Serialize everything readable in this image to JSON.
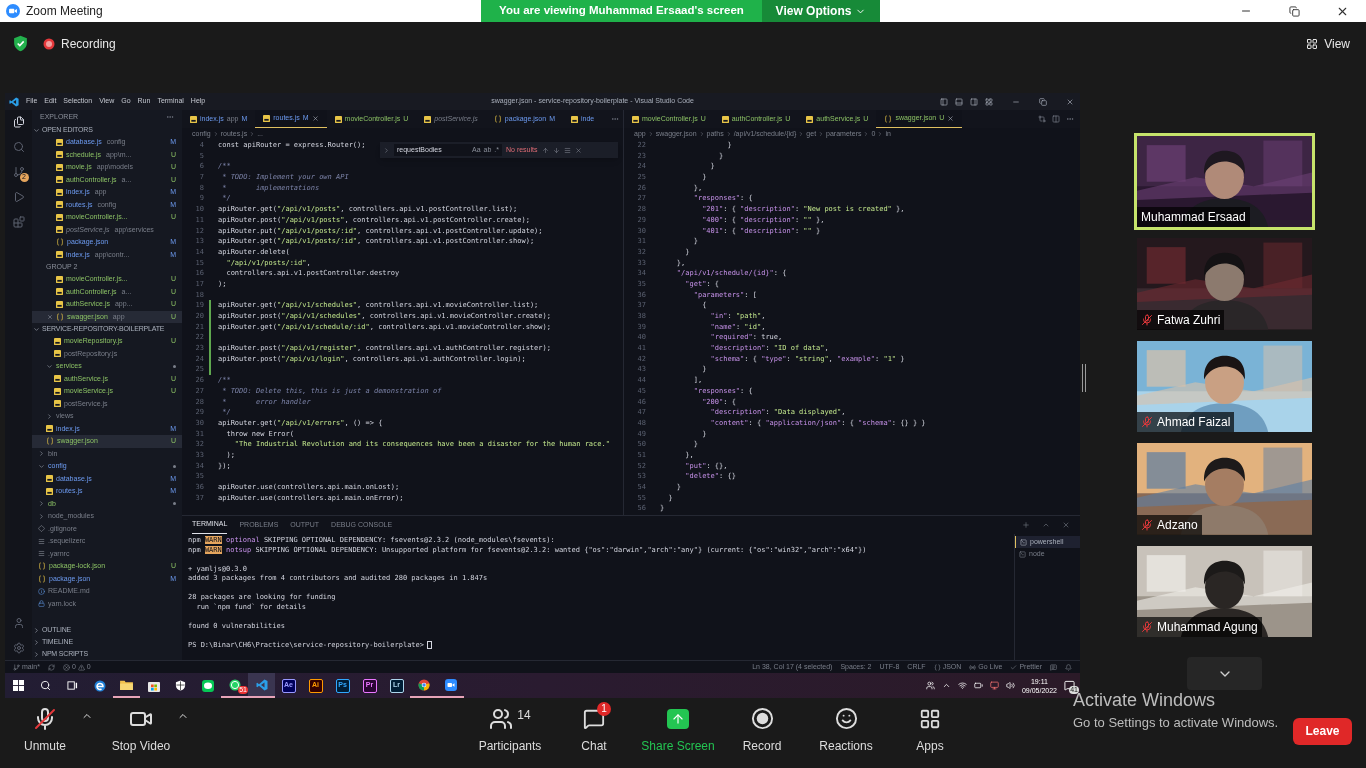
{
  "zoom": {
    "title": "Zoom Meeting",
    "banner": "You are viewing Muhammad Ersaad's screen",
    "view_options": "View Options",
    "recording": "Recording",
    "view": "View"
  },
  "vscode": {
    "menu": [
      "File",
      "Edit",
      "Selection",
      "View",
      "Go",
      "Run",
      "Terminal",
      "Help"
    ],
    "title": "swagger.json - service-repository-boilerplate - Visual Studio Code",
    "scm_badge": "2",
    "explorer": {
      "title": "EXPLORER",
      "open_editors": {
        "title": "OPEN EDITORS",
        "items": [
          {
            "name": "database.js",
            "detail": "config",
            "badge": "M",
            "kind": "js",
            "modified": true,
            "untracked": false,
            "selected": false
          },
          {
            "name": "schedule.js",
            "detail": "app\\m...",
            "badge": "U",
            "kind": "js",
            "modified": false,
            "untracked": true,
            "selected": false
          },
          {
            "name": "movie.js",
            "detail": "app\\models",
            "badge": "U",
            "kind": "js",
            "modified": false,
            "untracked": true,
            "selected": false
          },
          {
            "name": "authController.js",
            "detail": "a...",
            "badge": "U",
            "kind": "js",
            "modified": false,
            "untracked": true,
            "selected": false
          },
          {
            "name": "index.js",
            "detail": "app",
            "badge": "M",
            "kind": "js",
            "modified": true,
            "untracked": false,
            "selected": false
          },
          {
            "name": "routes.js",
            "detail": "config",
            "badge": "M",
            "kind": "js",
            "modified": true,
            "untracked": false,
            "selected": false
          },
          {
            "name": "movieController.js...",
            "badge": "U",
            "kind": "js",
            "modified": false,
            "untracked": true,
            "selected": false
          },
          {
            "name": "postService.js",
            "detail": "app\\services",
            "kind": "js",
            "modified": false,
            "untracked": false,
            "selected": false
          },
          {
            "name": "package.json",
            "badge": "M",
            "kind": "json",
            "modified": true,
            "untracked": false,
            "selected": false
          },
          {
            "name": "index.js",
            "detail": "app\\contr...",
            "badge": "M",
            "kind": "js",
            "modified": true,
            "untracked": false,
            "selected": false
          }
        ]
      },
      "group2": {
        "title": "GROUP 2",
        "items": [
          {
            "name": "movieController.js...",
            "badge": "U",
            "kind": "js",
            "modified": false,
            "untracked": true,
            "selected": false
          },
          {
            "name": "authController.js",
            "detail": "a...",
            "badge": "U",
            "kind": "js",
            "modified": false,
            "untracked": true,
            "selected": false
          },
          {
            "name": "authService.js",
            "detail": "app...",
            "badge": "U",
            "kind": "js",
            "modified": false,
            "untracked": true,
            "selected": false
          },
          {
            "name": "swagger.json",
            "detail": "app",
            "badge": "U",
            "kind": "json",
            "modified": false,
            "untracked": true,
            "selected": true
          }
        ]
      },
      "project": {
        "title": "SERVICE-REPOSITORY-BOILERPLATE",
        "items": [
          {
            "children": [
              {
                "children": [
                  {
                    "name": "movieRepository.js",
                    "badge": "U",
                    "kind": "js",
                    "modified": false,
                    "untracked": true,
                    "selected": false
                  },
                  {
                    "name": "postRepository.js",
                    "kind": "js",
                    "modified": false,
                    "untracked": false,
                    "selected": false
                  }
                ]
              },
              {
                "name": "services",
                "kind": "folder",
                "expanded": true,
                "dot": true,
                "modified": false,
                "untracked": true,
                "selected": false,
                "children": [
                  {
                    "name": "authService.js",
                    "badge": "U",
                    "kind": "js",
                    "modified": false,
                    "untracked": true,
                    "selected": false
                  },
                  {
                    "name": "movieService.js",
                    "badge": "U",
                    "kind": "js",
                    "modified": false,
                    "untracked": true,
                    "selected": false
                  },
                  {
                    "name": "postService.js",
                    "kind": "js",
                    "modified": false,
                    "untracked": false,
                    "selected": false
                  }
                ]
              },
              {
                "name": "views",
                "kind": "folder",
                "expanded": false,
                "dot": false,
                "modified": false,
                "untracked": false,
                "selected": false
              },
              {
                "name": "index.js",
                "badge": "M",
                "kind": "js",
                "modified": true,
                "untracked": false,
                "selected": false
              },
              {
                "name": "swagger.json",
                "badge": "U",
                "kind": "json",
                "modified": false,
                "untracked": true,
                "selected": true
              }
            ]
          },
          {
            "name": "bin",
            "kind": "folder",
            "expanded": false,
            "dot": false,
            "modified": false,
            "untracked": false,
            "selected": false
          },
          {
            "name": "config",
            "kind": "folder",
            "expanded": true,
            "dot": true,
            "modified": true,
            "untracked": false,
            "selected": false,
            "children": [
              {
                "name": "database.js",
                "badge": "M",
                "kind": "js",
                "modified": true,
                "untracked": false,
                "selected": false
              },
              {
                "name": "routes.js",
                "badge": "M",
                "kind": "js",
                "modified": true,
                "untracked": false,
                "selected": false
              }
            ]
          },
          {
            "name": "db",
            "kind": "folder",
            "expanded": false,
            "dot": true,
            "modified": false,
            "untracked": true,
            "selected": false
          },
          {
            "name": "node_modules",
            "kind": "folder",
            "expanded": false,
            "dot": false,
            "modified": false,
            "untracked": false,
            "selected": false
          },
          {
            "name": ".gitignore",
            "kind": "git",
            "modified": false,
            "untracked": false,
            "selected": false
          },
          {
            "name": ".sequelizerc",
            "kind": "config",
            "modified": false,
            "untracked": false,
            "selected": false
          },
          {
            "name": ".yarnrc",
            "kind": "config",
            "modified": false,
            "untracked": false,
            "selected": false
          },
          {
            "name": "package-lock.json",
            "badge": "U",
            "kind": "json",
            "modified": false,
            "untracked": true,
            "selected": false
          },
          {
            "name": "package.json",
            "badge": "M",
            "kind": "json",
            "modified": true,
            "untracked": false,
            "selected": false
          },
          {
            "name": "README.md",
            "kind": "md",
            "modified": false,
            "untracked": false,
            "selected": false
          },
          {
            "name": "yarn.lock",
            "kind": "lock",
            "modified": false,
            "untracked": false,
            "selected": false
          }
        ]
      },
      "sections": [
        "OUTLINE",
        "TIMELINE",
        "NPM SCRIPTS"
      ]
    },
    "editors": [
      {
        "tabs": [
          {
            "name": "index.js",
            "detail": "app",
            "badge": "M",
            "kind": "js",
            "modified": true,
            "untracked": false,
            "selected": false
          },
          {
            "name": "routes.js",
            "badge": "M",
            "kind": "js",
            "modified": true,
            "untracked": false,
            "selected": true
          },
          {
            "name": "movieController.js",
            "badge": "U",
            "kind": "js",
            "modified": false,
            "untracked": true,
            "selected": false
          },
          {
            "name": "postService.js",
            "kind": "js",
            "modified": false,
            "untracked": false,
            "selected": false
          },
          {
            "name": "package.json",
            "badge": "M",
            "kind": "json",
            "modified": true,
            "untracked": false,
            "selected": false
          },
          {
            "name": "inde",
            "kind": "js",
            "modified": true,
            "untracked": false,
            "selected": false
          }
        ],
        "breadcrumbs": [
          "config",
          "routes.js",
          "..."
        ],
        "find": {
          "value": "requestBodies",
          "options": [
            "Aa",
            "ab",
            ".*"
          ],
          "result": "No results"
        },
        "lines": [
          {
            "n": "4",
            "text": "const apiRouter = express.Router();",
            "kind": "code",
            "added": false
          },
          {
            "n": "5",
            "kind": "code",
            "added": false
          },
          {
            "n": "6",
            "text": "/**",
            "kind": "comment",
            "added": false
          },
          {
            "n": "7",
            "text": " * TODO: Implement your own API",
            "kind": "comment",
            "added": false
          },
          {
            "n": "8",
            "text": " *       implementations",
            "kind": "comment",
            "added": false
          },
          {
            "n": "9",
            "text": " */",
            "kind": "comment",
            "added": false
          },
          {
            "n": "10",
            "text": "apiRouter.get(\"/api/v1/posts\", controllers.api.v1.postController.list);",
            "kind": "code",
            "added": false
          },
          {
            "n": "11",
            "text": "apiRouter.post(\"/api/v1/posts\", controllers.api.v1.postController.create);",
            "kind": "code",
            "added": false
          },
          {
            "n": "12",
            "text": "apiRouter.put(\"/api/v1/posts/:id\", controllers.api.v1.postController.update);",
            "kind": "code",
            "added": false
          },
          {
            "n": "13",
            "text": "apiRouter.get(\"/api/v1/posts/:id\", controllers.api.v1.postController.show);",
            "kind": "code",
            "added": false
          },
          {
            "n": "14",
            "text": "apiRouter.delete(",
            "kind": "code",
            "added": false
          },
          {
            "n": "15",
            "text": "  \"/api/v1/posts/:id\",",
            "kind": "code",
            "added": false
          },
          {
            "n": "16",
            "text": "  controllers.api.v1.postController.destroy",
            "kind": "code",
            "added": false
          },
          {
            "n": "17",
            "text": ");",
            "kind": "code",
            "added": false
          },
          {
            "n": "18",
            "kind": "code",
            "added": false
          },
          {
            "n": "19",
            "text": "apiRouter.get(\"/api/v1/schedules\", controllers.api.v1.movieController.list);",
            "kind": "code",
            "added": true
          },
          {
            "n": "20",
            "text": "apiRouter.post(\"/api/v1/schedules\", controllers.api.v1.movieController.create);",
            "kind": "code",
            "added": true
          },
          {
            "n": "21",
            "text": "apiRouter.get(\"/api/v1/schedule/:id\", controllers.api.v1.movieController.show);",
            "kind": "code",
            "added": true
          },
          {
            "n": "22",
            "kind": "code",
            "added": true
          },
          {
            "n": "23",
            "text": "apiRouter.post(\"/api/v1/register\", controllers.api.v1.authController.register);",
            "kind": "code",
            "added": true
          },
          {
            "n": "24",
            "text": "apiRouter.post(\"/api/v1/login\", controllers.api.v1.authController.login);",
            "kind": "code",
            "added": true
          },
          {
            "n": "25",
            "kind": "code",
            "added": true
          },
          {
            "n": "26",
            "text": "/**",
            "kind": "comment",
            "added": false
          },
          {
            "n": "27",
            "text": " * TODO: Delete this, this is just a demonstration of",
            "kind": "comment",
            "added": false
          },
          {
            "n": "28",
            "text": " *       error handler",
            "kind": "comment",
            "added": false
          },
          {
            "n": "29",
            "text": " */",
            "kind": "comment",
            "added": false
          },
          {
            "n": "30",
            "text": "apiRouter.get(\"/api/v1/errors\", () => {",
            "kind": "code",
            "added": false
          },
          {
            "n": "31",
            "text": "  throw new Error(",
            "kind": "code",
            "added": false
          },
          {
            "n": "32",
            "text": "    \"The Industrial Revolution and its consequences have been a disaster for the human race.\"",
            "kind": "code",
            "added": false
          },
          {
            "n": "33",
            "text": "  );",
            "kind": "code",
            "added": false
          },
          {
            "n": "34",
            "text": "});",
            "kind": "code",
            "added": false
          },
          {
            "n": "35",
            "kind": "code",
            "added": false
          },
          {
            "n": "36",
            "text": "apiRouter.use(controllers.api.main.onLost);",
            "kind": "code",
            "added": false
          },
          {
            "n": "37",
            "text": "apiRouter.use(controllers.api.main.onError);",
            "kind": "code",
            "added": false
          }
        ]
      },
      {
        "tabs": [
          {
            "name": "movieController.js",
            "badge": "U",
            "kind": "js",
            "modified": false,
            "untracked": true,
            "selected": false
          },
          {
            "name": "authController.js",
            "badge": "U",
            "kind": "js",
            "modified": false,
            "untracked": true,
            "selected": false
          },
          {
            "name": "authService.js",
            "badge": "U",
            "kind": "js",
            "modified": false,
            "untracked": true,
            "selected": false
          },
          {
            "name": "swagger.json",
            "badge": "U",
            "kind": "json",
            "modified": false,
            "untracked": true,
            "selected": true
          }
        ],
        "breadcrumbs": [
          "app",
          "swagger.json",
          "paths",
          "/api/v1/schedule/{id}",
          "get",
          "parameters",
          "0",
          "in"
        ],
        "lines": [
          {
            "n": "22",
            "text": "                }",
            "kind": "code",
            "added": false
          },
          {
            "n": "23",
            "text": "              }",
            "kind": "code",
            "added": false
          },
          {
            "n": "24",
            "text": "            }",
            "kind": "code",
            "added": false
          },
          {
            "n": "25",
            "text": "          }",
            "kind": "code",
            "added": false
          },
          {
            "n": "26",
            "text": "        },",
            "kind": "code",
            "added": false
          },
          {
            "n": "27",
            "text": "        \"responses\": {",
            "kind": "code",
            "added": false
          },
          {
            "n": "28",
            "text": "          \"201\": { \"description\": \"New post is created\" },",
            "kind": "code",
            "added": false
          },
          {
            "n": "29",
            "text": "          \"400\": { \"description\": \"\" },",
            "kind": "code",
            "added": false
          },
          {
            "n": "30",
            "text": "          \"401\": { \"description\": \"\" }",
            "kind": "code",
            "added": false
          },
          {
            "n": "31",
            "text": "        }",
            "kind": "code",
            "added": false
          },
          {
            "n": "32",
            "text": "      }",
            "kind": "code",
            "added": false
          },
          {
            "n": "33",
            "text": "    },",
            "kind": "code",
            "added": false
          },
          {
            "n": "34",
            "text": "    \"/api/v1/schedule/{id}\": {",
            "kind": "code",
            "added": false
          },
          {
            "n": "35",
            "text": "      \"get\": {",
            "kind": "code",
            "added": false
          },
          {
            "n": "36",
            "text": "        \"parameters\": [",
            "kind": "code",
            "added": false
          },
          {
            "n": "37",
            "text": "          {",
            "kind": "code",
            "added": false
          },
          {
            "n": "38",
            "text": "            \"in\": \"path\",",
            "kind": "code",
            "added": false
          },
          {
            "n": "39",
            "text": "            \"name\": \"id\",",
            "kind": "code",
            "added": false
          },
          {
            "n": "40",
            "text": "            \"required\": true,",
            "kind": "code",
            "added": false
          },
          {
            "n": "41",
            "text": "            \"description\": \"ID of data\",",
            "kind": "code",
            "added": false
          },
          {
            "n": "42",
            "text": "            \"schema\": { \"type\": \"string\", \"example\": \"1\" }",
            "kind": "code",
            "added": false
          },
          {
            "n": "43",
            "text": "          }",
            "kind": "code",
            "added": false
          },
          {
            "n": "44",
            "text": "        ],",
            "kind": "code",
            "added": false
          },
          {
            "n": "45",
            "text": "        \"responses\": {",
            "kind": "code",
            "added": false
          },
          {
            "n": "46",
            "text": "          \"200\": {",
            "kind": "code",
            "added": false
          },
          {
            "n": "47",
            "text": "            \"description\": \"Data displayed\",",
            "kind": "code",
            "added": false
          },
          {
            "n": "48",
            "text": "            \"content\": { \"application/json\": { \"schema\": {} } }",
            "kind": "code",
            "added": false
          },
          {
            "n": "49",
            "text": "          }",
            "kind": "code",
            "added": false
          },
          {
            "n": "50",
            "text": "        }",
            "kind": "code",
            "added": false
          },
          {
            "n": "51",
            "text": "      },",
            "kind": "code",
            "added": false
          },
          {
            "n": "52",
            "text": "      \"put\": {},",
            "kind": "code",
            "added": false
          },
          {
            "n": "53",
            "text": "      \"delete\": {}",
            "kind": "code",
            "added": false
          },
          {
            "n": "54",
            "text": "    }",
            "kind": "code",
            "added": false
          },
          {
            "n": "55",
            "text": "  }",
            "kind": "code",
            "added": false
          },
          {
            "n": "56",
            "text": "}",
            "kind": "code",
            "added": false
          }
        ]
      }
    ],
    "panel": {
      "tabs": [
        {
          "label": "TERMINAL",
          "selected": true
        },
        {
          "label": "PROBLEMS",
          "selected": false
        },
        {
          "label": "OUTPUT",
          "selected": false
        },
        {
          "label": "DEBUG CONSOLE",
          "selected": false
        }
      ],
      "blocks": [
        [
          {
            "kind": "warn",
            "prefix": "npm",
            "tag": "WARN",
            "keyword": "optional",
            "text": "SKIPPING OPTIONAL DEPENDENCY: fsevents@2.3.2 (node_modules\\fsevents):"
          },
          {
            "kind": "warn",
            "prefix": "npm",
            "tag": "WARN",
            "keyword": "notsup",
            "text": "SKIPPING OPTIONAL DEPENDENCY: Unsupported platform for fsevents@2.3.2: wanted {\"os\":\"darwin\",\"arch\":\"any\"} (current: {\"os\":\"win32\",\"arch\":\"x64\"})"
          }
        ],
        [
          {
            "kind": "plain",
            "text": "+ yamljs@0.3.0"
          },
          {
            "kind": "plain",
            "text": "added 3 packages from 4 contributors and audited 280 packages in 1.847s"
          }
        ],
        [
          {
            "kind": "plain",
            "text": "28 packages are looking for funding"
          },
          {
            "kind": "plain",
            "text": "  run `npm fund` for details"
          }
        ],
        [
          {
            "kind": "plain",
            "text": "found 0 vulnerabilities"
          }
        ],
        [
          {
            "kind": "prompt",
            "text": "PS D:\\Binar\\CH6\\Practice\\service-repository-boilerplate>"
          }
        ]
      ],
      "terminals": [
        {
          "label": "powershell",
          "selected": true
        },
        {
          "label": "node",
          "selected": false
        }
      ]
    },
    "status": {
      "branch": "main*",
      "errors": "0",
      "warnings": "0",
      "items": [
        {
          "kind": "text",
          "label": "Ln 38, Col 17 (4 selected)"
        },
        {
          "kind": "text",
          "label": "Spaces: 2"
        },
        {
          "kind": "text",
          "label": "UTF-8"
        },
        {
          "kind": "text",
          "label": "CRLF"
        },
        {
          "kind": "language",
          "label": "JSON"
        },
        {
          "kind": "live",
          "label": "Go Live"
        },
        {
          "kind": "check",
          "label": "Prettier"
        }
      ]
    }
  },
  "taskbar": {
    "apps": [
      {
        "kind": "windows",
        "running": false
      },
      {
        "kind": "search",
        "running": false
      },
      {
        "kind": "taskview",
        "running": false
      },
      {
        "kind": "edge",
        "running": false
      },
      {
        "kind": "explorer",
        "running": true
      },
      {
        "kind": "store",
        "running": false
      },
      {
        "kind": "security",
        "running": false
      },
      {
        "kind": "line",
        "running": false
      },
      {
        "kind": "whatsapp",
        "running": true,
        "badge": "51"
      },
      {
        "kind": "vscode",
        "running": true
      },
      {
        "kind": "adobe",
        "label": "Ae",
        "running": false
      },
      {
        "kind": "adobe",
        "label": "Ai",
        "running": false
      },
      {
        "kind": "adobe",
        "label": "Ps",
        "running": false
      },
      {
        "kind": "adobe",
        "label": "Pr",
        "running": false
      },
      {
        "kind": "adobe",
        "label": "Lr",
        "running": false
      },
      {
        "kind": "chrome",
        "running": true
      },
      {
        "kind": "zoom",
        "running": true
      }
    ],
    "time": "19:11",
    "date": "09/05/2022",
    "notifications": "41"
  },
  "participants": [
    {
      "name": "Muhammad Ersaad",
      "speaking": true,
      "muted": false
    },
    {
      "name": "Fatwa Zuhri",
      "speaking": false,
      "muted": true
    },
    {
      "name": "Ahmad Faizal",
      "speaking": false,
      "muted": true
    },
    {
      "name": "Adzano",
      "speaking": false,
      "muted": true
    },
    {
      "name": "Muhammad Agung",
      "speaking": false,
      "muted": true
    }
  ],
  "toolbar": {
    "items": [
      {
        "kind": "mic",
        "label": "Unmute",
        "muted": true,
        "caret": true
      },
      {
        "kind": "video",
        "label": "Stop Video",
        "caret": true
      },
      {
        "kind": "participants",
        "label": "Participants",
        "count": "14",
        "caret": false
      },
      {
        "kind": "chat",
        "label": "Chat",
        "badge": "1",
        "caret": false
      },
      {
        "kind": "share",
        "label": "Share Screen",
        "caret": false
      },
      {
        "kind": "record",
        "label": "Record",
        "caret": false
      },
      {
        "kind": "reactions",
        "label": "Reactions",
        "caret": false
      },
      {
        "kind": "apps",
        "label": "Apps",
        "caret": false
      }
    ],
    "leave": "Leave"
  },
  "activation": {
    "title": "Activate Windows",
    "hint": "Go to Settings to activate Windows."
  }
}
